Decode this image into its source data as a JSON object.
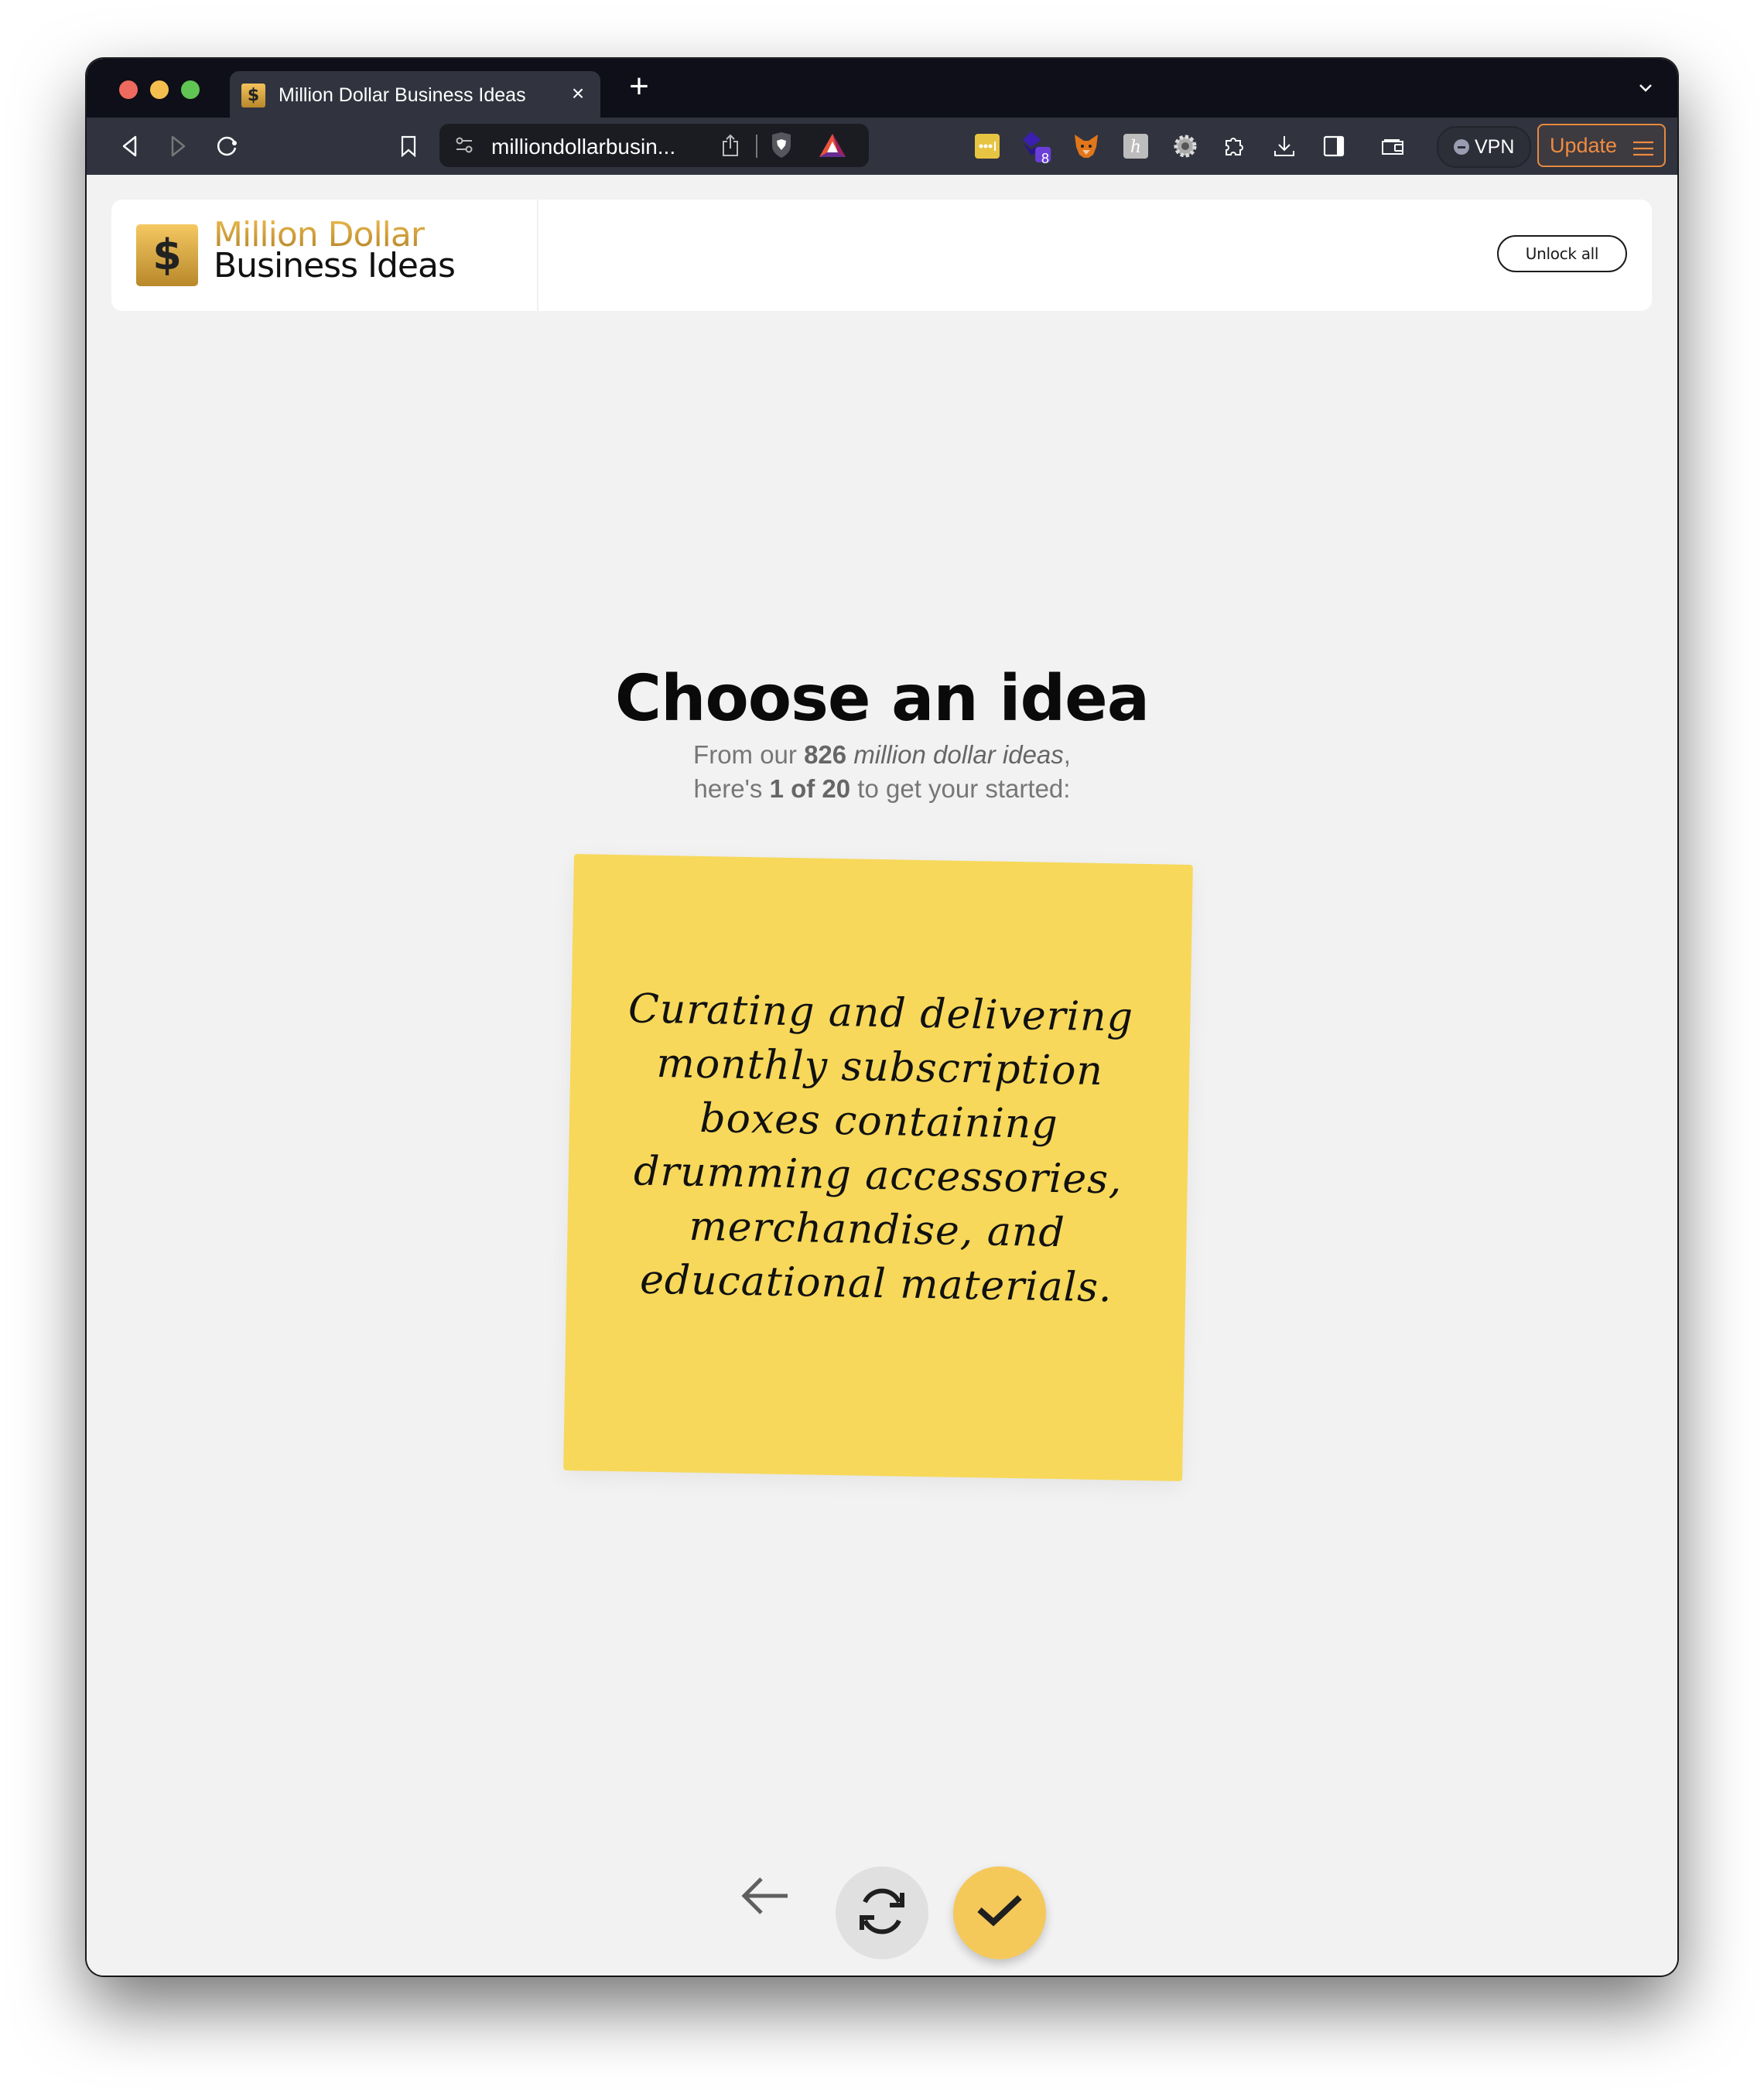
{
  "browser": {
    "tab": {
      "title": "Million Dollar Business Ideas",
      "favicon_symbol": "$",
      "close_symbol": "×"
    },
    "new_tab_symbol": "+",
    "address": {
      "url_display": "milliondollarbusin..."
    },
    "vpn_label": "VPN",
    "update_label": "Update",
    "extension_badge_count": "8",
    "icons": {
      "back": "back-icon",
      "forward": "forward-icon",
      "reload": "reload-icon",
      "bookmark": "bookmark-icon",
      "site_settings": "site-settings-icon",
      "share": "share-icon",
      "brave_shields": "brave-shields-icon",
      "rewards": "brave-rewards-icon",
      "extensions": [
        "lastpass-icon",
        "layers-extension-icon",
        "metamask-icon",
        "honey-icon",
        "gear-extension-icon"
      ],
      "puzzle": "extensions-icon",
      "download": "download-icon",
      "sidebar": "sidebar-icon",
      "wallet": "wallet-icon",
      "menu": "menu-icon",
      "tab_list": "chevron-down-icon"
    }
  },
  "site": {
    "logo": {
      "symbol": "$",
      "line1": "Million Dollar",
      "line2": "Business Ideas"
    },
    "unlock_label": "Unlock all",
    "title": "Choose an idea",
    "subtitle": {
      "prefix": "From our ",
      "count": "826",
      "emph": "million dollar ideas",
      "line1_suffix": ",",
      "line2_prefix": "here's ",
      "position": "1 of 20",
      "line2_suffix": " to get your started:"
    },
    "idea_text": "Curating and delivering monthly subscription boxes containing drumming accessories, merchandise, and educational materials.",
    "actions": {
      "back": "back-arrow-icon",
      "shuffle": "refresh-icon",
      "confirm": "check-icon"
    },
    "colors": {
      "note": "#f7d85a",
      "confirm": "#f5c85a",
      "gold": "#c7982f",
      "update_orange": "#ef8c40"
    }
  }
}
